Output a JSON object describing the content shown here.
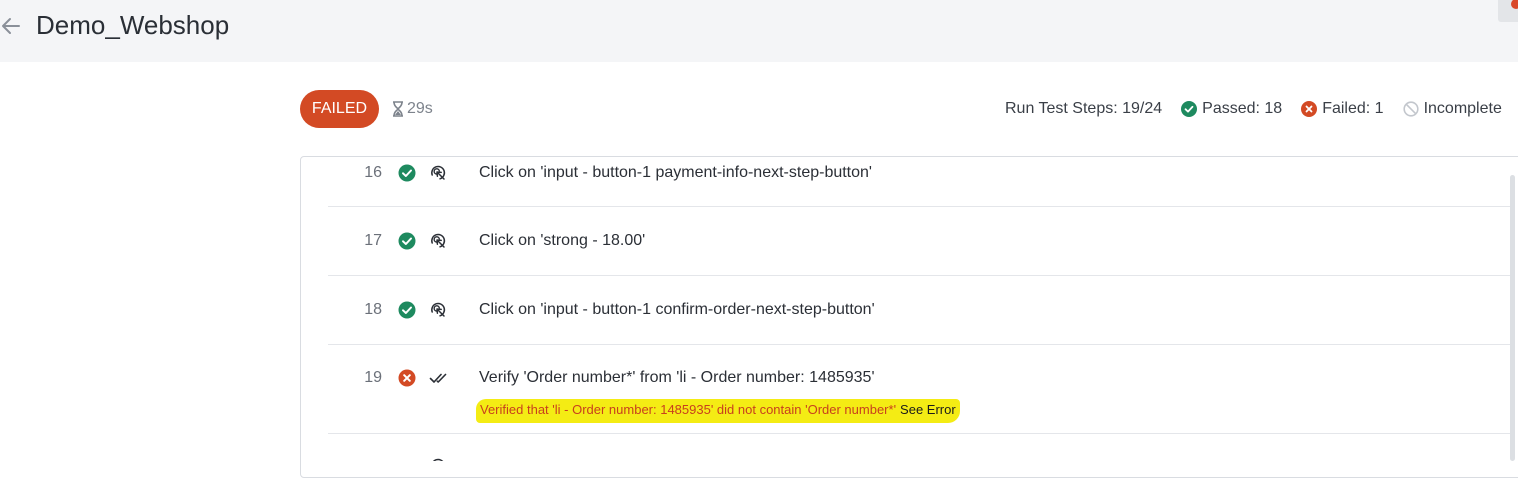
{
  "header": {
    "title": "Demo_Webshop",
    "back_icon": "arrow-left-icon"
  },
  "run": {
    "status": "FAILED",
    "duration": "29s",
    "steps_label": "Run Test Steps: 19/24",
    "passed_label": "Passed: 18",
    "failed_label": "Failed: 1",
    "incomplete_label": "Incomplete"
  },
  "colors": {
    "failed": "#d34a24",
    "passed": "#1e8a5f",
    "highlight": "#f4ec14"
  },
  "steps": [
    {
      "number": "16",
      "status": "passed",
      "type": "click",
      "description": "Click on 'input - button-1 payment-info-next-step-button'"
    },
    {
      "number": "17",
      "status": "passed",
      "type": "click",
      "description": "Click on 'strong - 18.00'"
    },
    {
      "number": "18",
      "status": "passed",
      "type": "click",
      "description": "Click on 'input - button-1 confirm-order-next-step-button'"
    },
    {
      "number": "19",
      "status": "failed",
      "type": "verify",
      "description": "Verify 'Order number*' from 'li - Order number: 1485935'",
      "error": "Verified that 'li - Order number: 1485935' did not contain 'Order number*'",
      "error_link": "See Error"
    }
  ]
}
